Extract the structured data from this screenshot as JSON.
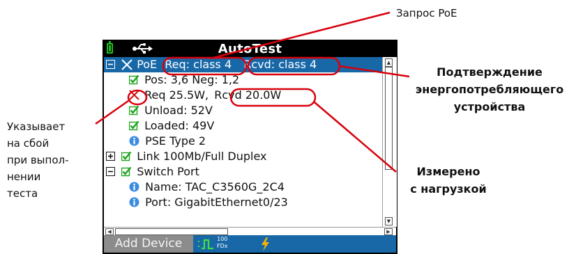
{
  "device": {
    "title": "AutoTest",
    "tree": [
      {
        "id": "poe",
        "text": "PoE",
        "req": "Req: class 4",
        "rcvd": "Rcvd: class 4",
        "expander": "minus",
        "status": "fail",
        "selected": true
      },
      {
        "id": "pos-neg",
        "text": "Pos: 3,6 Neg: 1,2",
        "status": "pass"
      },
      {
        "id": "power",
        "text": "Req 25.5W,",
        "rcvd": "Rcvd 20.0W",
        "status": "fail"
      },
      {
        "id": "unload",
        "text": "Unload: 52V",
        "status": "pass"
      },
      {
        "id": "loaded",
        "text": "Loaded: 49V",
        "status": "pass"
      },
      {
        "id": "pse-type",
        "text": "PSE Type 2",
        "status": "info"
      },
      {
        "id": "link",
        "text": "Link 100Mb/Full Duplex",
        "expander": "plus",
        "status": "pass"
      },
      {
        "id": "switch-port",
        "text": "Switch Port",
        "expander": "minus",
        "status": "pass"
      },
      {
        "id": "switch-name",
        "text": "Name: TAC_C3560G_2C4",
        "status": "info"
      },
      {
        "id": "switch-port-id",
        "text": "Port: GigabitEthernet0/23",
        "status": "info"
      }
    ],
    "status_bar": {
      "add_device": "Add Device",
      "link_speed_top": "100",
      "link_speed_bottom": "FDx"
    },
    "colors": {
      "selection": "#1868a8",
      "pass_check": "#1aa31a",
      "fail_x": "#d01010",
      "annotation": "#d8000c"
    }
  },
  "annotations": {
    "poe_request": "Запрос PoE",
    "device_confirmation": [
      "Подтверждение",
      "энергопотребляющего",
      "устройства"
    ],
    "measured_load": [
      "Измерено",
      "с нагрузкой"
    ],
    "failure_indicator": [
      "Указывает",
      "на сбой",
      "при выпол-",
      "нении",
      "теста"
    ]
  }
}
